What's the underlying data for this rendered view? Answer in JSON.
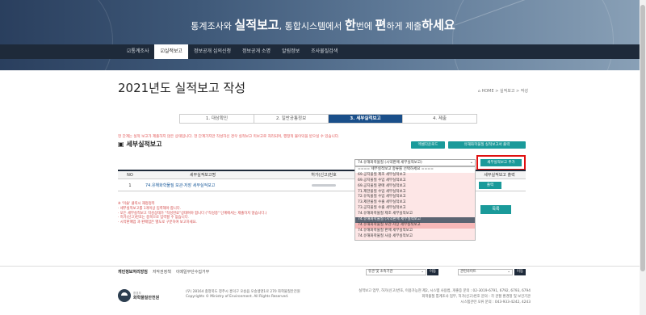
{
  "hero": {
    "slogan_pre": "통계조사와 ",
    "slogan_b1": "실적보고",
    "slogan_mid": ", 통합시스템에서 ",
    "slogan_b2": "한",
    "slogan_mid2": "번에 ",
    "slogan_b3": "편",
    "slogan_post": "하게 제출",
    "slogan_b4": "하세요"
  },
  "nav": {
    "items": [
      "☑통계조사",
      "☑실적보고",
      "정보공개 심의신청",
      "정보공개 소명",
      "알림정보",
      "조사물질검색"
    ],
    "active_index": 1
  },
  "page": {
    "title": "2021년도 실적보고 작성",
    "breadcrumb": "⌂ HOME > 실적보고 > 작성"
  },
  "steps": [
    "1. 대상확인",
    "2. 일반공통정보",
    "3. 세부실적보고",
    "4. 제출"
  ],
  "notice": "현 단계는 실적 보고가 제출하지 않은 상태입니다. 현 단계가지만 작성하신 경우 실적보고 미보고로 처리되며, 행정적 불이익을 받으실 수 있습니다.",
  "section_title": "▣ 세부실적보고",
  "buttons": {
    "excel": "엑셀다운로드",
    "print": "유해화학물질 실적보고서 출력",
    "add": "세부실적보고 추가",
    "row_print": "출력",
    "list": "목록"
  },
  "select": {
    "value": "74.유해화학물질 (시약판매 세부실적보고)"
  },
  "table": {
    "headers": [
      "NO",
      "세부실적보고명",
      "허가(신고)번호",
      "세부실적보고 출력"
    ],
    "rows": [
      {
        "no": "1",
        "name": "74.유해화학물질 보관·저장 세부실적보고",
        "permit": "",
        "action": "출력"
      }
    ]
  },
  "notes": [
    "※ '이술' 클릭시 재정정목",
    "  · 세부실적보고를 1개이상 입력해야 합니다.",
    "  · 모든 세부실적보고 작성상태가 \"작성완료\"상태여야 합니다 (\"작성중\" 단계에서는 제출하지 않습니다.)",
    "  · 허가(신고)번호는 중복으로 입력할 수 없습니다.",
    "  · 시약판매업 과 판매업은 별도로 구분하여 보고하세요."
  ],
  "dropdown": {
    "options": [
      "==== 세부실적보고 종류를 선택하세요 ====",
      "69.공지물질 제조 세부실적보고",
      "69.공지물질 수입 세부실적보고",
      "69.공지물질 판매 세부실적보고",
      "71.제한물질 수입 세부실적보고",
      "72.유독물질 수입 세부실적보고",
      "73.제한물질 수출 세부실적보고",
      "73.공지물질 수출 세부실적보고",
      "74.유해화학물질 제조 세부실적보고",
      "74.유해화학물질 (시약판매 세부실적보고",
      "74.유해화학물질 보관·저장 세부실적보고",
      "74.유해화학물질 판매 세부실적보고",
      "74.유해화학물질 사용 세부실적보고"
    ],
    "highlight_index": 9
  },
  "footer": {
    "links": [
      "개인정보처리방침",
      "저작권정책",
      "이메일무단수집거부"
    ],
    "sel1": "유관 및 소속기관",
    "sel2": "관련사이트",
    "go": "이동",
    "logo_small": "환경부",
    "logo_name": "화학물질안전원",
    "address": "(우) 28164 충청북도 청주시 흥덕구 오송읍 오송생명1로 270 화학물질안전원",
    "copyright": "Copyrights © Ministry of Environment. All Rights Reserved.",
    "contact1": "실적보고 업무, 허가(신고)번호, 이용가능현 제2, 시스템 사용법, 개좋증 문의 : 02-3019-6791, 6792, 6793, 6794",
    "contact2": "화학물질 통계조사 업무, 허가(신고)번호 문의 : 각 관할 환경청 및 보건기관",
    "contact3": "시스템관련 오류 문의 : 043-933-4242, 4243"
  }
}
